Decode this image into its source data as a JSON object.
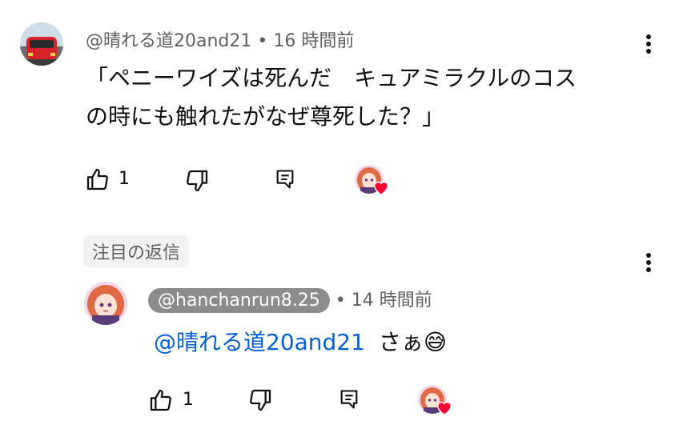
{
  "comment": {
    "author": "@晴れる道20and21",
    "time": "16 時間前",
    "separator": "•",
    "text_line1": "「ペニーワイズは死んだ　キュアミラクルのコス",
    "text_line2": "の時にも触れたがなぜ尊死した？」",
    "likes": "1"
  },
  "reply": {
    "pinned_label": "注目の返信",
    "author": "@hanchanrun8.25",
    "time": "14 時間前",
    "separator": "•",
    "mention": "@晴れる道20and21",
    "text": "さぁ",
    "emoji": "😅",
    "likes": "1"
  },
  "colors": {
    "mention": "#065fd4",
    "heart": "#ff0033",
    "meta": "#606060",
    "handle_chip": "#8c8c8c"
  },
  "icons": [
    "like-icon",
    "dislike-icon",
    "reply-icon",
    "creator-heart-icon",
    "more-options-icon"
  ]
}
